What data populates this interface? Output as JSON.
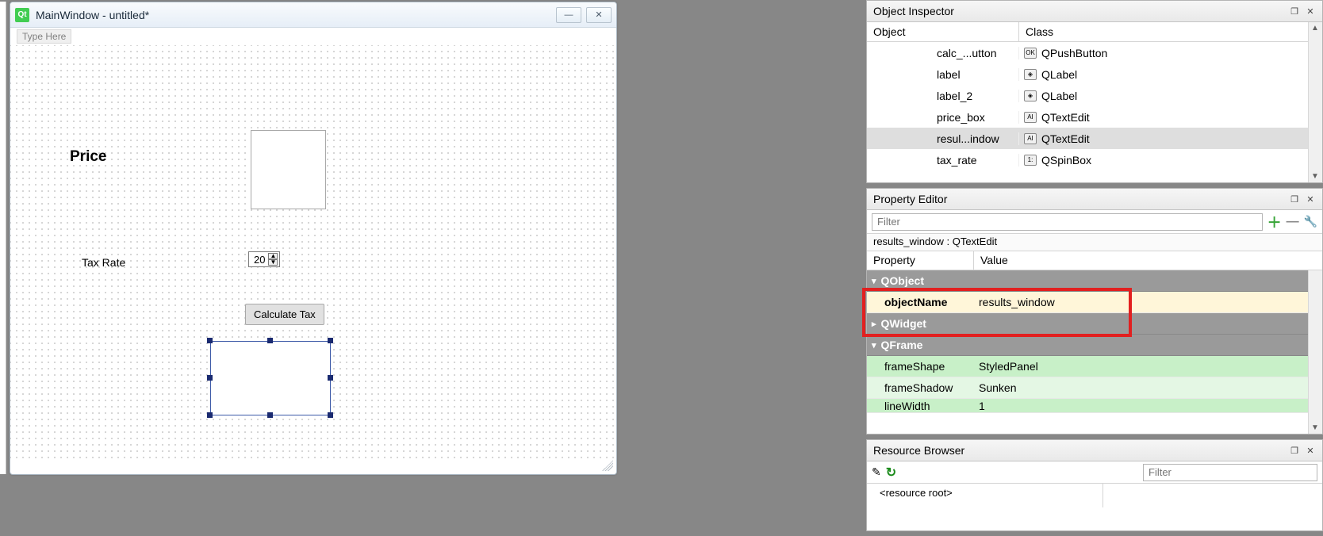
{
  "designWindow": {
    "qtLabel": "Qt",
    "title": "MainWindow - untitled*",
    "typeHere": "Type Here",
    "priceLabel": "Price",
    "taxRateLabel": "Tax Rate",
    "taxRateValue": "20",
    "calcButton": "Calculate Tax"
  },
  "objectInspector": {
    "title": "Object Inspector",
    "colObject": "Object",
    "colClass": "Class",
    "rows": [
      {
        "obj": "calc_...utton",
        "cls": "QPushButton",
        "icon": "OK"
      },
      {
        "obj": "label",
        "cls": "QLabel",
        "icon": "◈"
      },
      {
        "obj": "label_2",
        "cls": "QLabel",
        "icon": "◈"
      },
      {
        "obj": "price_box",
        "cls": "QTextEdit",
        "icon": "AI"
      },
      {
        "obj": "resul...indow",
        "cls": "QTextEdit",
        "icon": "AI"
      },
      {
        "obj": "tax_rate",
        "cls": "QSpinBox",
        "icon": "1:"
      }
    ],
    "selectedIndex": 4
  },
  "propertyEditor": {
    "title": "Property Editor",
    "filterPlaceholder": "Filter",
    "objectLine": "results_window : QTextEdit",
    "colProperty": "Property",
    "colValue": "Value",
    "groups": {
      "qobject": {
        "label": "QObject",
        "expanded": true,
        "row": {
          "name": "objectName",
          "value": "results_window"
        }
      },
      "qwidget": {
        "label": "QWidget",
        "expanded": false
      },
      "qframe": {
        "label": "QFrame",
        "expanded": true,
        "rows": [
          {
            "name": "frameShape",
            "value": "StyledPanel"
          },
          {
            "name": "frameShadow",
            "value": "Sunken"
          },
          {
            "name": "lineWidth",
            "value": "1"
          }
        ]
      }
    }
  },
  "resourceBrowser": {
    "title": "Resource Browser",
    "filterPlaceholder": "Filter",
    "rootLabel": "<resource root>"
  }
}
